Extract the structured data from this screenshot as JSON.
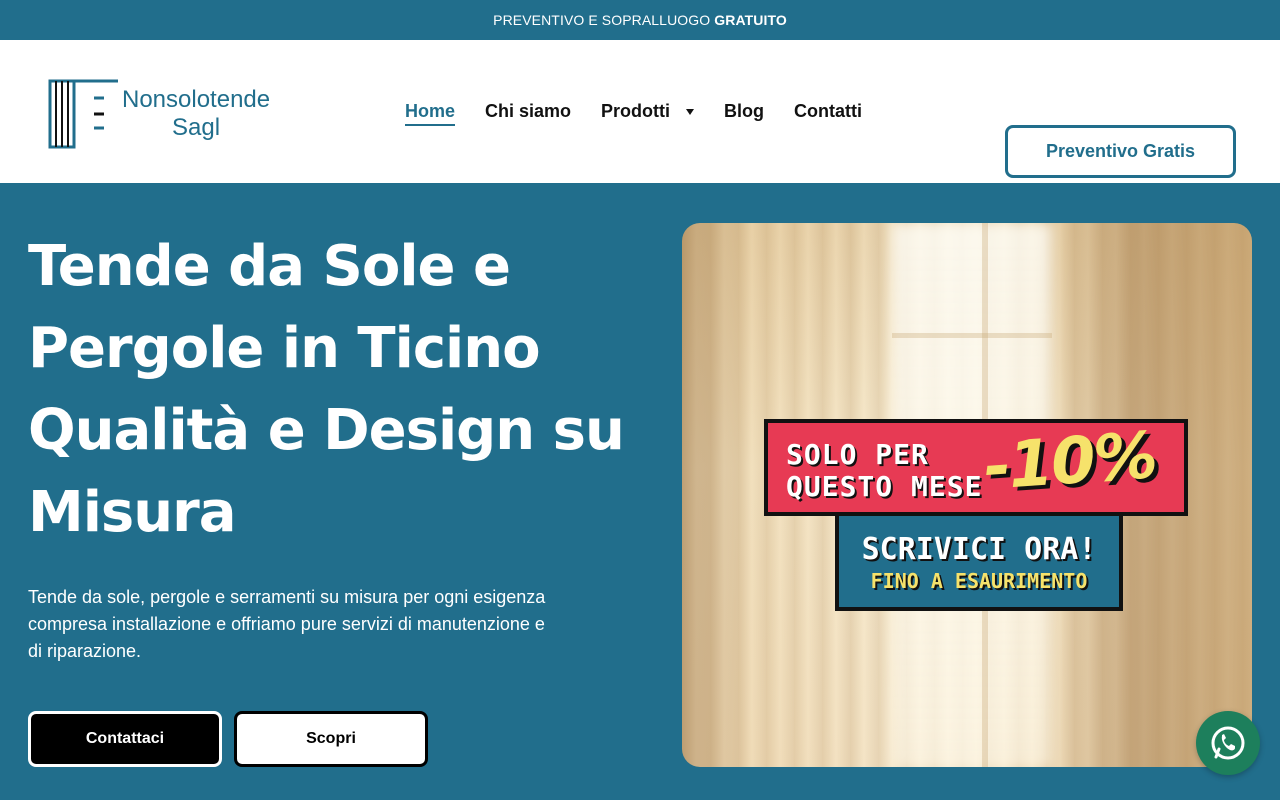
{
  "topbar": {
    "text": "PREVENTIVO E SOPRALLUOGO",
    "highlight": "GRATUITO"
  },
  "brand": {
    "line1": "Nonsolotende",
    "line2": "Sagl",
    "color": "#216e8c"
  },
  "nav": {
    "items": [
      {
        "label": "Home",
        "active": true
      },
      {
        "label": "Chi siamo"
      },
      {
        "label": "Prodotti",
        "has_dropdown": true
      },
      {
        "label": "Blog"
      },
      {
        "label": "Contatti"
      }
    ]
  },
  "header_cta": "Preventivo Gratis",
  "hero": {
    "title_lines": [
      "Tende da Sole e",
      "Pergole in Ticino",
      "Qualità e Design su",
      "Misura"
    ],
    "description": "Tende da sole, pergole e serramenti su misura per ogni esigenza compresa installazione e offriamo pure servizi di manutenzione e di riparazione.",
    "buttons": {
      "primary": "Contattaci",
      "secondary": "Scopri"
    }
  },
  "promo": {
    "line1": "SOLO PER",
    "line2": "QUESTO MESE",
    "discount": "-10%",
    "cta": "SCRIVICI ORA!",
    "sub": "FINO A ESAURIMENTO"
  },
  "icons": {
    "whatsapp": "whatsapp-icon",
    "dropdown": "chevron-down-icon"
  },
  "colors": {
    "primary": "#216e8c",
    "promo_red": "#e73a54",
    "promo_yellow": "#f6e26b",
    "whatsapp": "#1d7f5c"
  }
}
